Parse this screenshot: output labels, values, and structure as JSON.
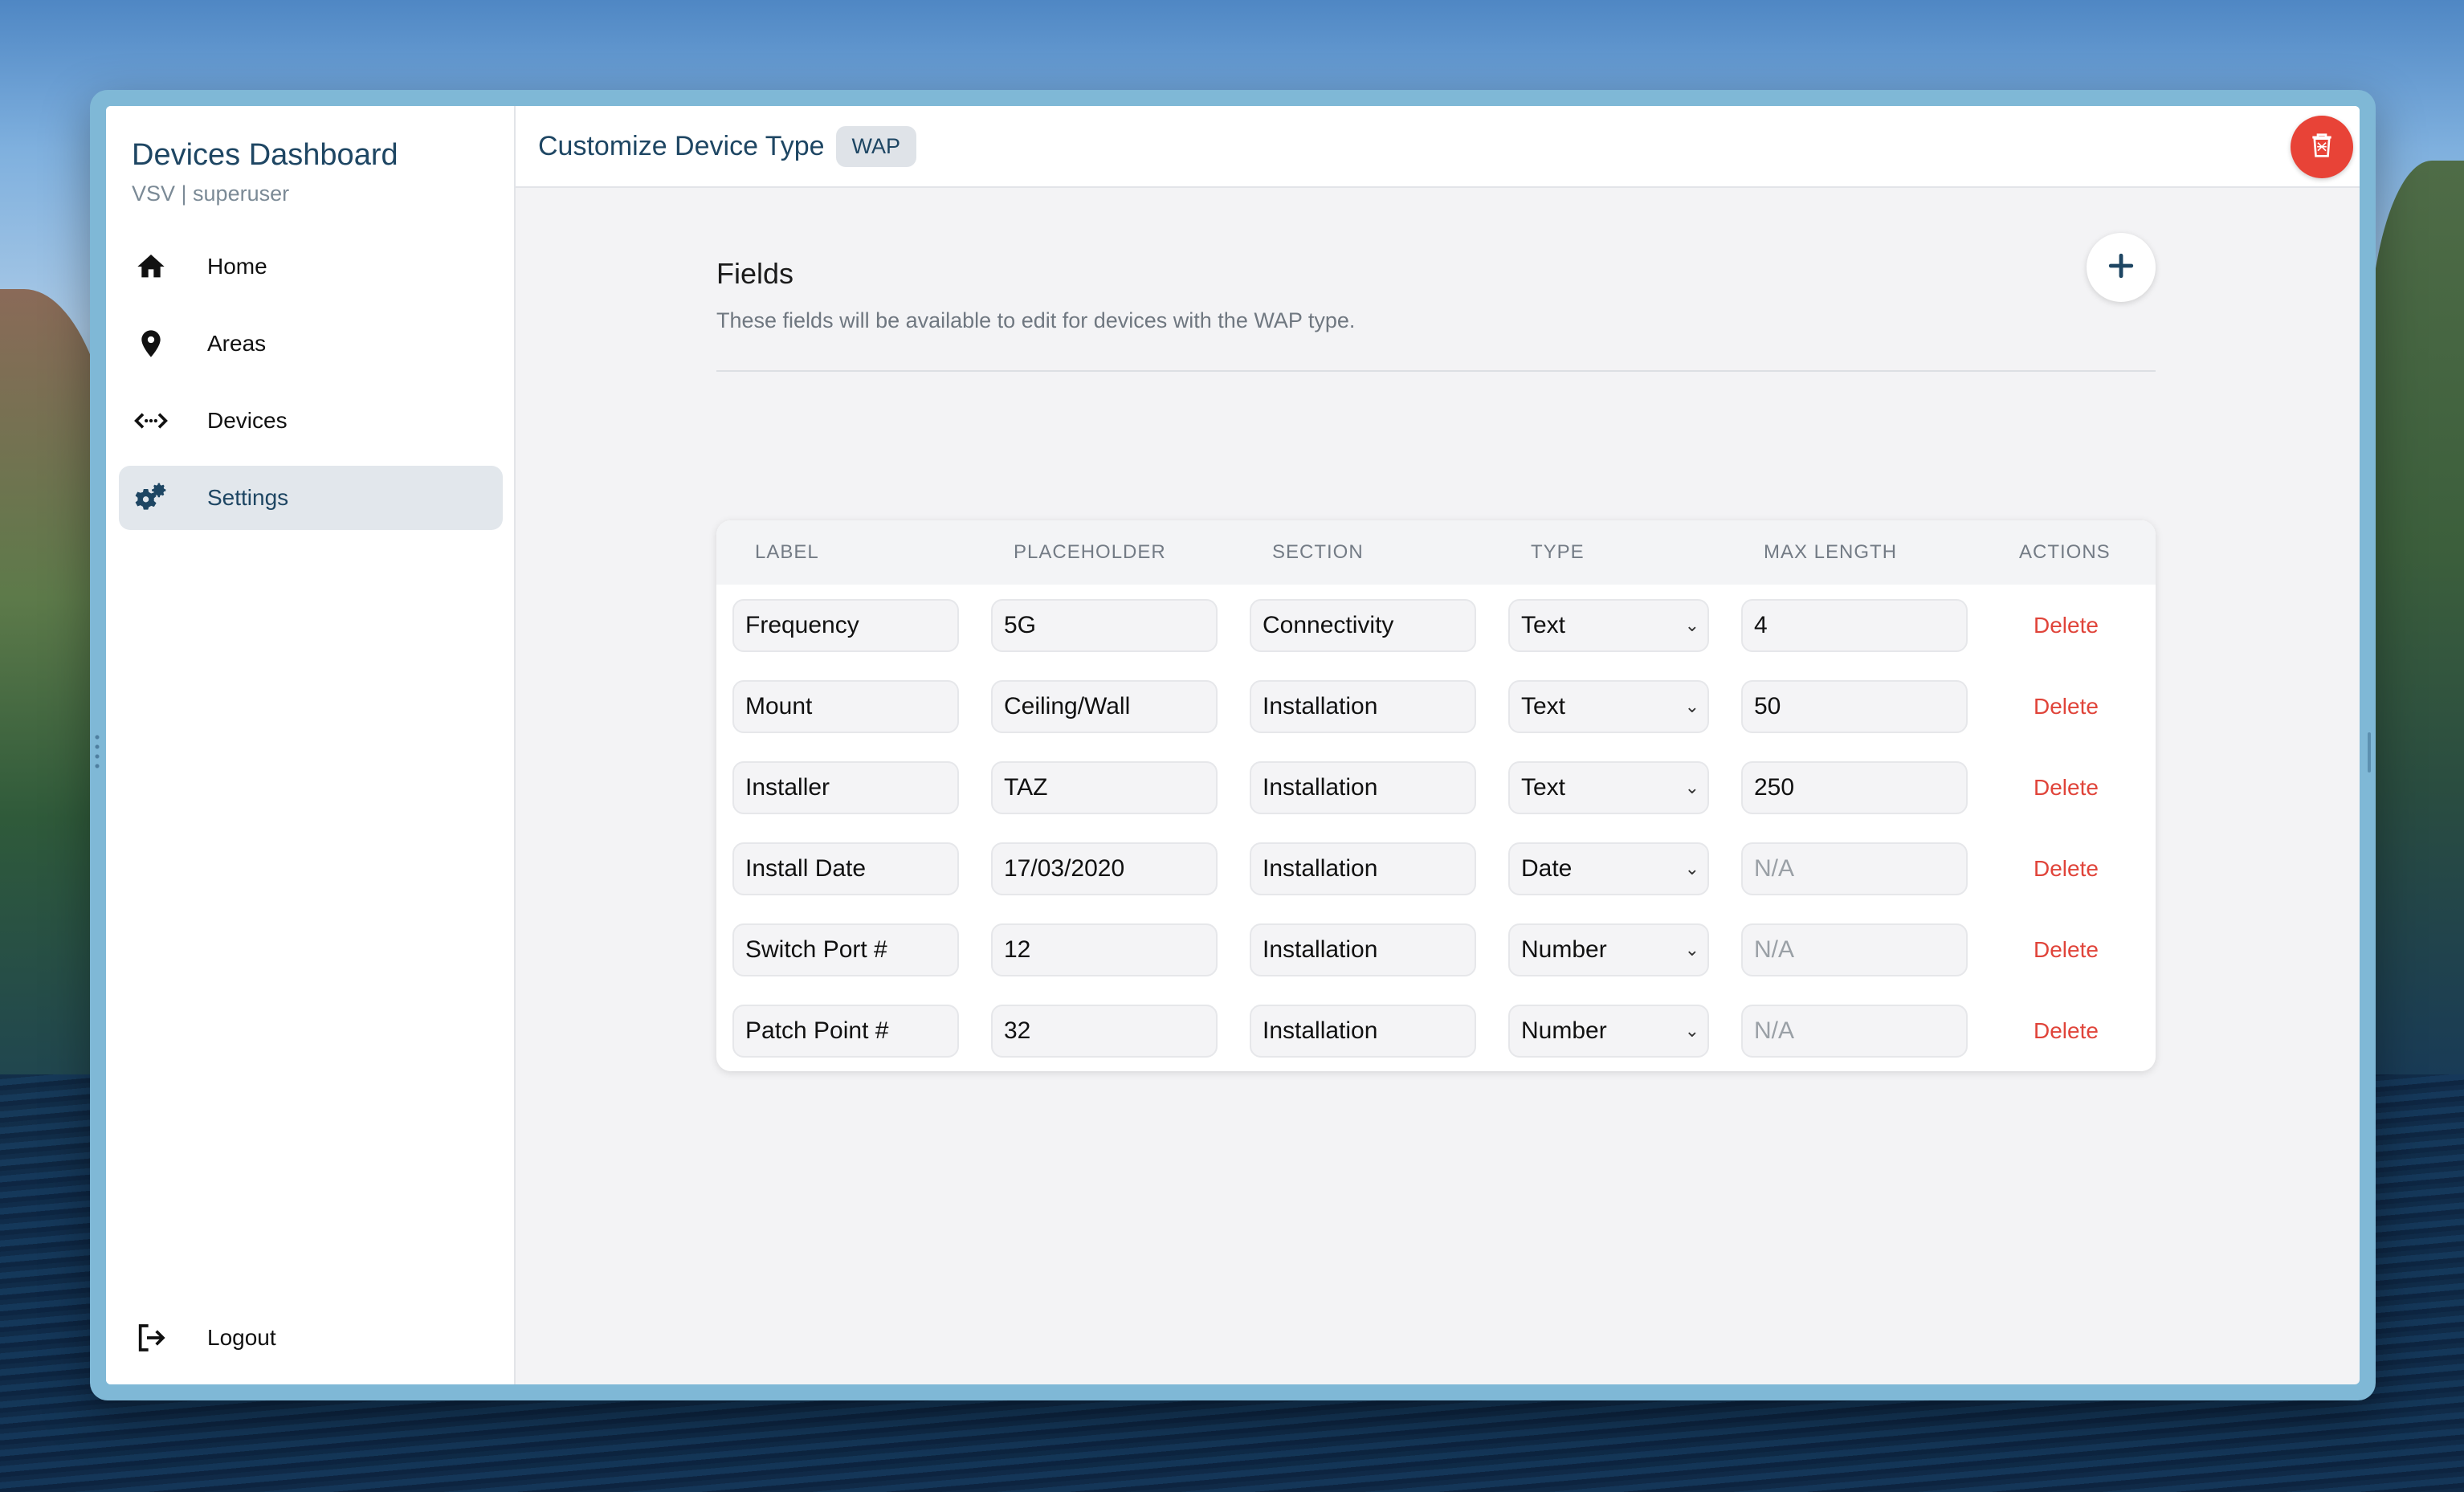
{
  "sidebar": {
    "title": "Devices Dashboard",
    "subtitle": "VSV | superuser",
    "items": [
      {
        "label": "Home",
        "icon": "home-icon"
      },
      {
        "label": "Areas",
        "icon": "map-pin-icon"
      },
      {
        "label": "Devices",
        "icon": "code-arrows-icon"
      },
      {
        "label": "Settings",
        "icon": "settings-gear-icon",
        "active": true
      }
    ],
    "logout_label": "Logout"
  },
  "header": {
    "title": "Customize Device Type",
    "badge": "WAP"
  },
  "fields_section": {
    "title": "Fields",
    "description": "These fields will be available to edit for devices with the WAP type."
  },
  "table": {
    "columns": [
      "LABEL",
      "PLACEHOLDER",
      "SECTION",
      "TYPE",
      "MAX LENGTH",
      "ACTIONS"
    ],
    "delete_label": "Delete",
    "rows": [
      {
        "label": "Frequency",
        "placeholder": "5G",
        "section": "Connectivity",
        "type": "Text",
        "max_length": "4"
      },
      {
        "label": "Mount",
        "placeholder": "Ceiling/Wall",
        "section": "Installation",
        "type": "Text",
        "max_length": "50"
      },
      {
        "label": "Installer",
        "placeholder": "TAZ",
        "section": "Installation",
        "type": "Text",
        "max_length": "250"
      },
      {
        "label": "Install Date",
        "placeholder": "17/03/2020",
        "section": "Installation",
        "type": "Date",
        "max_length": "N/A"
      },
      {
        "label": "Switch Port #",
        "placeholder": "12",
        "section": "Installation",
        "type": "Number",
        "max_length": "N/A"
      },
      {
        "label": "Patch Point #",
        "placeholder": "32",
        "section": "Installation",
        "type": "Number",
        "max_length": "N/A"
      }
    ]
  },
  "colors": {
    "accent": "#1e4663",
    "danger": "#e84337",
    "delete_text": "#e0443a"
  }
}
